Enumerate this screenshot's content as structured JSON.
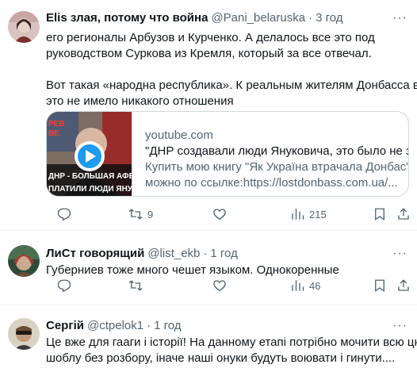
{
  "tweets": [
    {
      "name": "Elis злая, потому что война",
      "handle": "@Pani_belaruska",
      "time": "3 год",
      "more": "···",
      "lines": [
        "его регионалы Арбузов и Курченко. А делалось все это под",
        "руководством Суркова из Кремля, который за все отвечал.",
        "",
        "Вот такая «народна республика». К реальным жителям Донбасса все",
        "это не имело никакого отношения"
      ],
      "card": {
        "domain": "youtube.com",
        "title": "\"ДНР создавали люди Януковича, это было не за и",
        "desc1": "Купить мою книгу \"Як Україна втрачала Донбас\"",
        "desc2": "можно по ссылке:https://lostdonbass.com.ua/...",
        "thumb_top_text": "РЕВ",
        "thumb_top_text2": "ВЕ",
        "thumb_text1": "ДНР - БОЛЬШАЯ АФЕРА",
        "thumb_text2": "ПЛАТИЛИ ЛЮДИ ЯНУК"
      },
      "actions": {
        "retweets": "9",
        "views": "215"
      }
    },
    {
      "name": "ЛиСт говорящий",
      "handle": "@list_ekb",
      "time": "1 год",
      "more": "···",
      "lines": [
        "Губерниев тоже много чешет языком. Однокоренные"
      ],
      "actions": {
        "views": "46"
      }
    },
    {
      "name": "Сергій",
      "handle": "@ctpelok1",
      "time": "1 год",
      "more": "···",
      "lines": [
        "Це вже для гааги і історії! На данному етапі потрібно мочити всю цю",
        "шоблу без розбору, іначе наші онуки будуть воювати і гинути...."
      ]
    }
  ],
  "colors": {
    "text": "#0f1419",
    "secondary": "#536471",
    "border": "#cfd9de",
    "divider": "#eff3f4",
    "play": "#1d9bf0"
  },
  "icons": [
    "reply-icon",
    "retweet-icon",
    "like-icon",
    "views-icon",
    "bookmark-icon",
    "share-icon",
    "play-icon",
    "more-icon"
  ]
}
